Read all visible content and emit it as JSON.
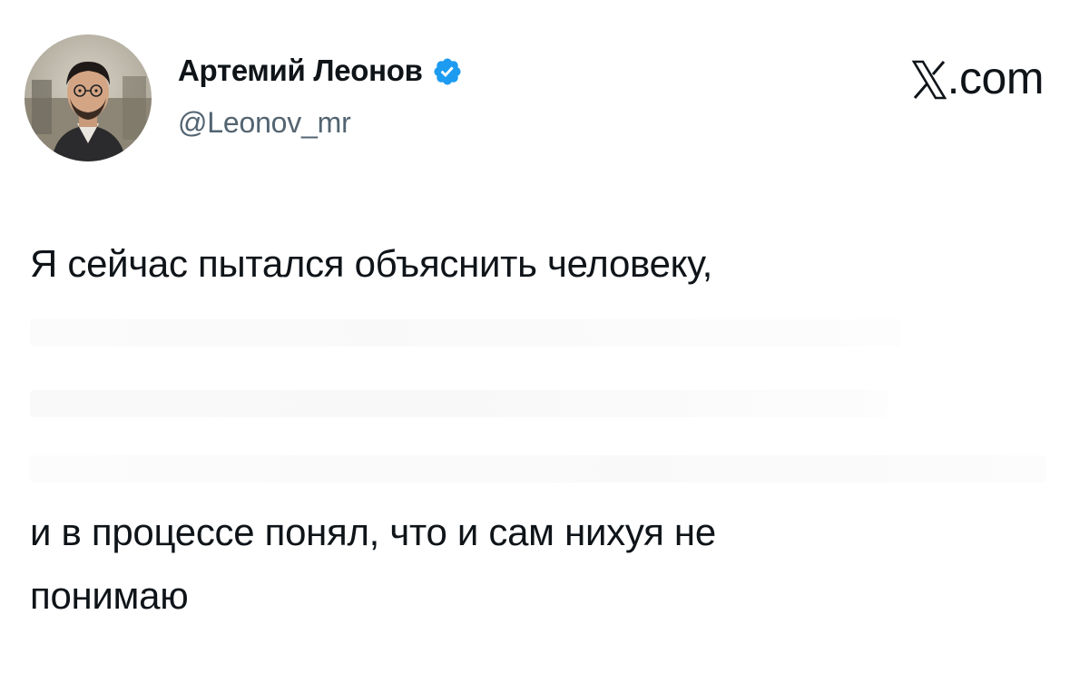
{
  "header": {
    "display_name": "Артемий Леонов",
    "handle": "@Leonov_mr",
    "avatar_icon": "profile-photo",
    "verified_icon": "verified-badge-icon",
    "verified_color": "#1d9bf0"
  },
  "brand": {
    "logo_icon": "x-logo-icon",
    "domain": ".com"
  },
  "tweet": {
    "lines": [
      "Я сейчас пытался объяснить человеку,",
      "и в процессе понял, что и сам нихуя не",
      "понимаю"
    ]
  },
  "colors": {
    "text": "#0f1419",
    "secondary": "#536471",
    "accent": "#1d9bf0",
    "background": "#ffffff"
  }
}
